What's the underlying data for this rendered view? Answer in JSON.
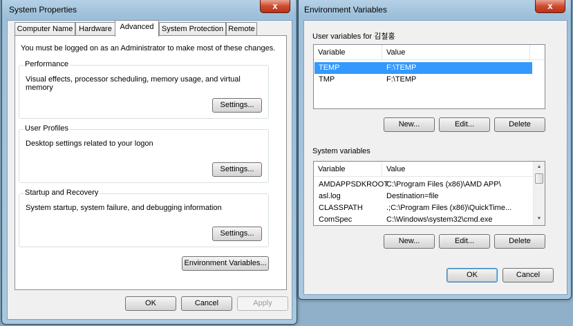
{
  "system_properties": {
    "title": "System Properties",
    "close_glyph": "x",
    "tabs": [
      {
        "label": "Computer Name"
      },
      {
        "label": "Hardware"
      },
      {
        "label": "Advanced"
      },
      {
        "label": "System Protection"
      },
      {
        "label": "Remote"
      }
    ],
    "active_tab": "Advanced",
    "admin_notice": "You must be logged on as an Administrator to make most of these changes.",
    "groups": {
      "performance": {
        "label": "Performance",
        "description": "Visual effects, processor scheduling, memory usage, and virtual memory",
        "button": "Settings..."
      },
      "user_profiles": {
        "label": "User Profiles",
        "description": "Desktop settings related to your logon",
        "button": "Settings..."
      },
      "startup_recovery": {
        "label": "Startup and Recovery",
        "description": "System startup, system failure, and debugging information",
        "button": "Settings..."
      }
    },
    "env_button": "Environment Variables...",
    "ok_label": "OK",
    "cancel_label": "Cancel",
    "apply_label": "Apply"
  },
  "environment_variables": {
    "title": "Environment Variables",
    "close_glyph": "x",
    "user_section_label": "User variables for 김철홍",
    "user_columns": [
      "Variable",
      "Value"
    ],
    "user_rows": [
      {
        "variable": "TEMP",
        "value": "F:\\TEMP",
        "selected": true
      },
      {
        "variable": "TMP",
        "value": "F:\\TEMP",
        "selected": false
      }
    ],
    "user_buttons": {
      "new": "New...",
      "edit": "Edit...",
      "delete": "Delete"
    },
    "system_section_label": "System variables",
    "system_columns": [
      "Variable",
      "Value"
    ],
    "system_rows": [
      {
        "variable": "AMDAPPSDKROOT",
        "value": "C:\\Program Files (x86)\\AMD APP\\"
      },
      {
        "variable": "asl.log",
        "value": "Destination=file"
      },
      {
        "variable": "CLASSPATH",
        "value": ".;C:\\Program Files (x86)\\QuickTime..."
      },
      {
        "variable": "ComSpec",
        "value": "C:\\Windows\\system32\\cmd.exe"
      }
    ],
    "system_buttons": {
      "new": "New...",
      "edit": "Edit...",
      "delete": "Delete"
    },
    "ok_label": "OK",
    "cancel_label": "Cancel"
  },
  "icons": {
    "scroll_up": "▲",
    "scroll_down": "▼"
  },
  "colors": {
    "selection": "#3399ff",
    "close_button": "#cf4a2e",
    "window_frame": "#a9c8df"
  }
}
